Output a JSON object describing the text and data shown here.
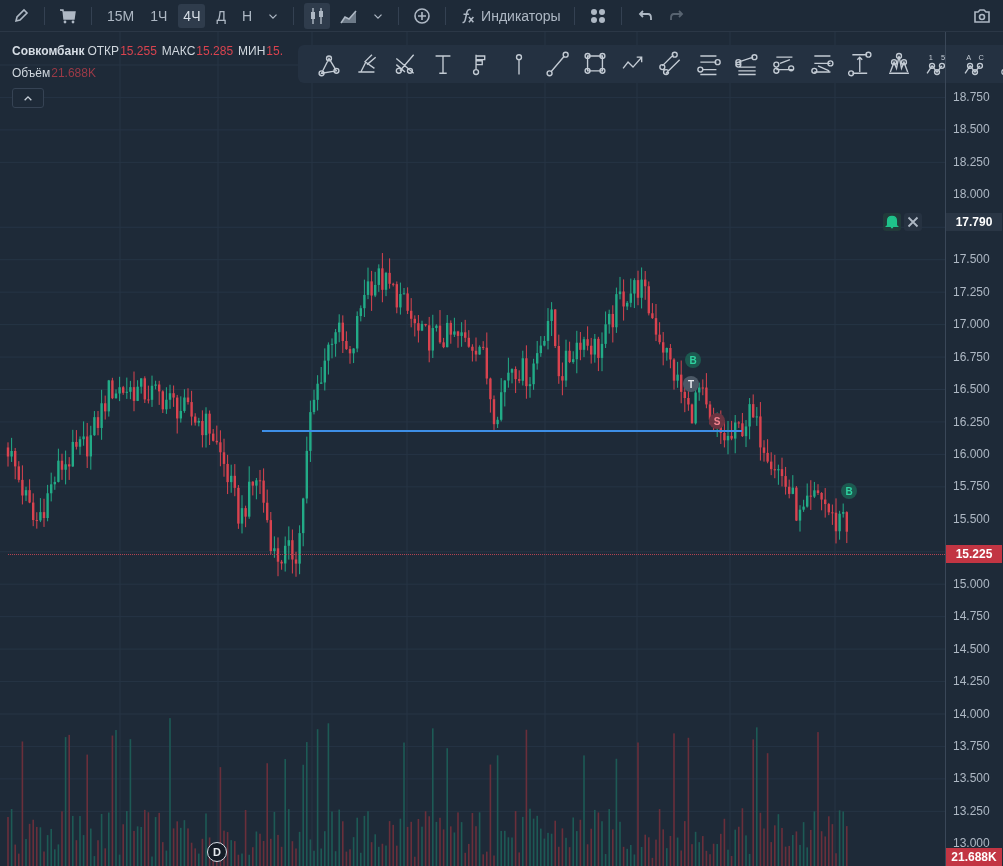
{
  "toolbar": {
    "timeframes": [
      {
        "label": "15М",
        "selected": false
      },
      {
        "label": "1Ч",
        "selected": false
      },
      {
        "label": "4Ч",
        "selected": true
      },
      {
        "label": "Д",
        "selected": false
      },
      {
        "label": "Н",
        "selected": false
      }
    ],
    "chart_types": [
      {
        "kind": "candles",
        "selected": true
      },
      {
        "kind": "area",
        "selected": false
      }
    ],
    "indicators": "Индикаторы",
    "undo": {
      "disabled": false
    },
    "redo": {
      "disabled": true
    }
  },
  "legend": {
    "symbol": "Совкомбанк",
    "fields": [
      {
        "label": "ОТКР",
        "value": "15.255"
      },
      {
        "label": "МАКС",
        "value": "15.285"
      },
      {
        "label": "МИН",
        "value": "15."
      }
    ],
    "volume": {
      "label": "Объём",
      "value": "21.688K"
    }
  },
  "drawing_tools": [
    {
      "kind": "triangle"
    },
    {
      "kind": "brush"
    },
    {
      "kind": "cross"
    },
    {
      "kind": "text"
    },
    {
      "kind": "flag"
    },
    {
      "kind": "pin"
    },
    {
      "kind": "line"
    },
    {
      "kind": "rect"
    },
    {
      "kind": "path"
    },
    {
      "kind": "parallel"
    },
    {
      "kind": "hlines"
    },
    {
      "kind": "fan"
    },
    {
      "kind": "fib"
    },
    {
      "kind": "fib2"
    },
    {
      "kind": "range"
    },
    {
      "kind": "hs"
    },
    {
      "kind": "wave",
      "marks": [
        "1",
        "5"
      ]
    },
    {
      "kind": "wave",
      "marks": [
        "A",
        "C"
      ]
    },
    {
      "kind": "daterange"
    }
  ],
  "price_axis": [
    "18.750",
    "18.500",
    "18.250",
    "18.000",
    "17.500",
    "17.250",
    "17.000",
    "16.750",
    "16.500",
    "16.250",
    "16.000",
    "15.750",
    "15.500",
    "15.000",
    "14.750",
    "14.500",
    "14.250",
    "14.000",
    "13.750",
    "13.500",
    "13.250",
    "13.000"
  ],
  "alert_tag": {
    "price": "17.790"
  },
  "last_price_tag": "15.225",
  "volume_tag": "21.688K",
  "trade_marks": [
    {
      "label": "B",
      "kind": "buy"
    },
    {
      "label": "T",
      "kind": "take"
    },
    {
      "label": "S",
      "kind": "sell"
    },
    {
      "label": "B",
      "kind": "buy"
    }
  ],
  "dividend_mark": "D"
}
